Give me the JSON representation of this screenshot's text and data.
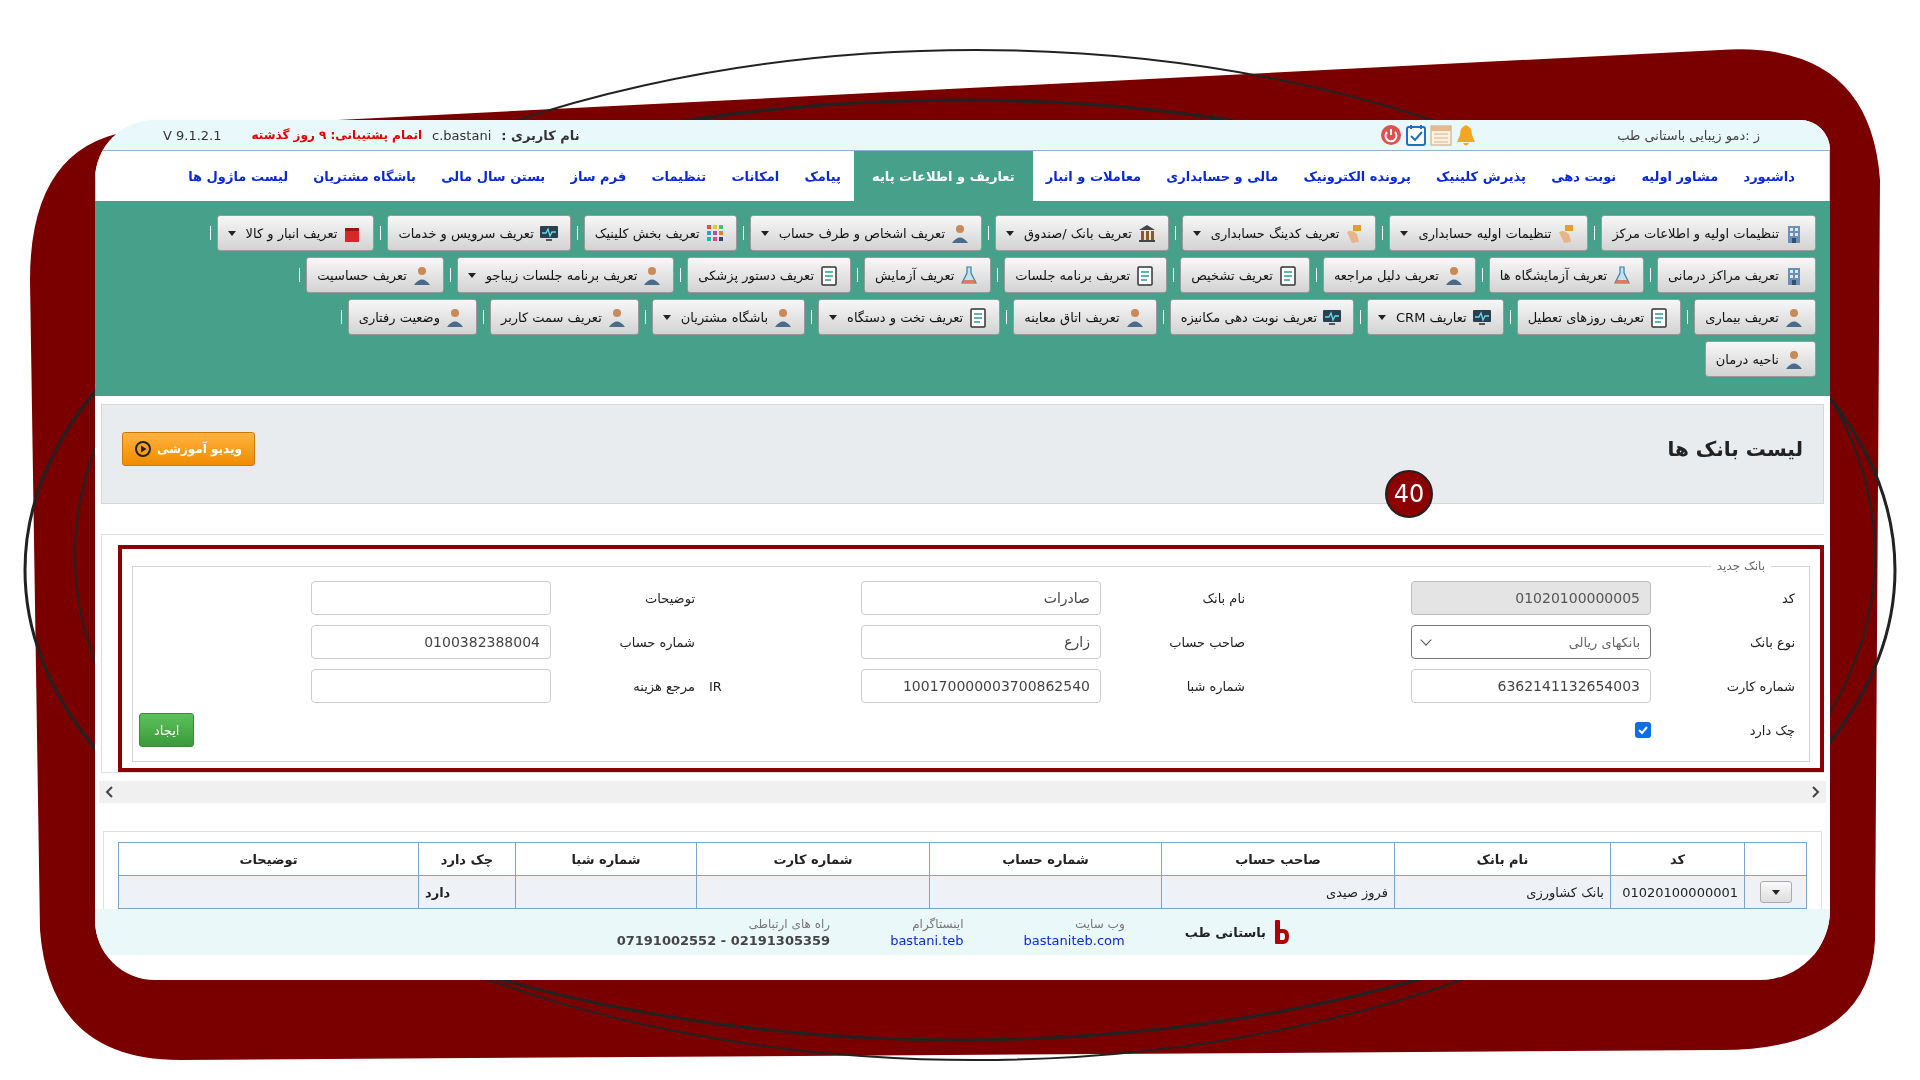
{
  "header": {
    "version": "V 9.1.2.1",
    "support_warning": "اتمام پشتیبانی: ۹ روز گذشته",
    "username_label": "نام کاربری :",
    "username": "c.bastani",
    "center": "ز :دمو زیبایی باستانی طب"
  },
  "menu": [
    {
      "label": "داشبورد",
      "selected": false
    },
    {
      "label": "مشاور اولیه",
      "selected": false
    },
    {
      "label": "نوبت دهی",
      "selected": false
    },
    {
      "label": "پذیرش کلینیک",
      "selected": false
    },
    {
      "label": "پرونده الکترونیک",
      "selected": false
    },
    {
      "label": "مالی و حسابداری",
      "selected": false
    },
    {
      "label": "معاملات و انبار",
      "selected": false
    },
    {
      "label": "تعاریف و اطلاعات پایه",
      "selected": true
    },
    {
      "label": "پیامک",
      "selected": false
    },
    {
      "label": "امکانات",
      "selected": false
    },
    {
      "label": "تنظیمات",
      "selected": false
    },
    {
      "label": "فرم ساز",
      "selected": false
    },
    {
      "label": "بستن سال مالی",
      "selected": false
    },
    {
      "label": "باشگاه مشتریان",
      "selected": false
    },
    {
      "label": "لیست ماژول ها",
      "selected": false
    }
  ],
  "toolbar": [
    [
      {
        "label": "تنظیمات اولیه و اطلاعات مرکز",
        "dropdown": false
      },
      {
        "label": "تنظیمات اولیه حسابداری",
        "dropdown": true
      },
      {
        "label": "تعریف کدینگ حسابداری",
        "dropdown": true
      },
      {
        "label": "تعریف بانک /صندوق",
        "dropdown": true
      },
      {
        "label": "تعریف اشخاص و طرف حساب",
        "dropdown": true
      },
      {
        "label": "تعریف بخش کلینیک",
        "dropdown": false
      },
      {
        "label": "تعریف سرویس و خدمات",
        "dropdown": false
      },
      {
        "label": "تعریف انبار و کالا",
        "dropdown": true
      }
    ],
    [
      {
        "label": "تعریف مراکز درمانی",
        "dropdown": false
      },
      {
        "label": "تعریف آزمایشگاه ها",
        "dropdown": false
      },
      {
        "label": "تعریف دلیل مراجعه",
        "dropdown": false
      },
      {
        "label": "تعریف تشخیص",
        "dropdown": false
      },
      {
        "label": "تعریف برنامه جلسات",
        "dropdown": false
      },
      {
        "label": "تعریف آزمایش",
        "dropdown": false
      },
      {
        "label": "تعریف دستور پزشکی",
        "dropdown": false
      },
      {
        "label": "تعریف برنامه جلسات زیباجو",
        "dropdown": true
      },
      {
        "label": "تعریف حساسیت",
        "dropdown": false
      }
    ],
    [
      {
        "label": "تعریف بیماری",
        "dropdown": false
      },
      {
        "label": "تعریف روزهای تعطیل",
        "dropdown": false
      },
      {
        "label": "تعاریف CRM",
        "dropdown": true
      },
      {
        "label": "تعریف نوبت دهی مکانیزه",
        "dropdown": false
      },
      {
        "label": "تعریف اتاق معاینه",
        "dropdown": false
      },
      {
        "label": "تعریف تخت و دستگاه",
        "dropdown": true
      },
      {
        "label": "باشگاه مشتریان",
        "dropdown": true
      },
      {
        "label": "تعریف سمت کاربر",
        "dropdown": false
      },
      {
        "label": "وضعیت رفتاری",
        "dropdown": false
      }
    ],
    [
      {
        "label": "ناحیه درمان",
        "dropdown": false
      }
    ]
  ],
  "page": {
    "title": "لیست بانک ها",
    "video_button": "ویدیو آموزشی",
    "step_badge": "40"
  },
  "form": {
    "legend": "بانک جدید",
    "fields": [
      {
        "label": "کد",
        "value": "01020100000005",
        "kind": "text",
        "disabled": true
      },
      {
        "label": "نام بانک",
        "value": "صادرات",
        "kind": "text",
        "disabled": false
      },
      {
        "label": "توضیحات",
        "kind": "text",
        "disabled": false
      },
      {
        "label": "نوع بانک",
        "value": "بانکهای ریالی",
        "kind": "select",
        "disabled": false
      },
      {
        "label": "صاحب حساب",
        "value": "زارع",
        "kind": "text",
        "disabled": false
      },
      {
        "label": "شماره حساب",
        "value": "0100382388004",
        "kind": "text",
        "disabled": false
      },
      {
        "label": "شماره کارت",
        "value": "6362141132654003",
        "kind": "text",
        "disabled": false
      },
      {
        "label": "شماره شبا",
        "value": "100170000003700862540",
        "prefix": "IR",
        "kind": "text",
        "disabled": false
      },
      {
        "label": "مرجع هزینه",
        "kind": "text",
        "disabled": false
      }
    ],
    "has_check": {
      "label": "چک دارد",
      "checked": true
    },
    "submit": "ایجاد"
  },
  "table": {
    "columns": [
      "کد",
      "نام بانک",
      "صاحب حساب",
      "شماره حساب",
      "شماره کارت",
      "شماره شبا",
      "چک دارد",
      "توضیحات"
    ],
    "rows": [
      {
        "cells": [
          "01020100000001",
          "بانک کشاورزی",
          "فروز صیدی",
          null,
          null,
          null,
          "دارد",
          null
        ]
      }
    ]
  },
  "footer": {
    "brand": "باستانی طب",
    "contacts": [
      {
        "label": "وب سایت",
        "value": "bastaniteb.com",
        "kind": "link"
      },
      {
        "label": "اینستاگرام",
        "value": "bastani.teb",
        "kind": "link"
      },
      {
        "label": "راه های ارتباطی",
        "value": "07191002552 - 02191305359",
        "kind": "phone"
      }
    ]
  }
}
